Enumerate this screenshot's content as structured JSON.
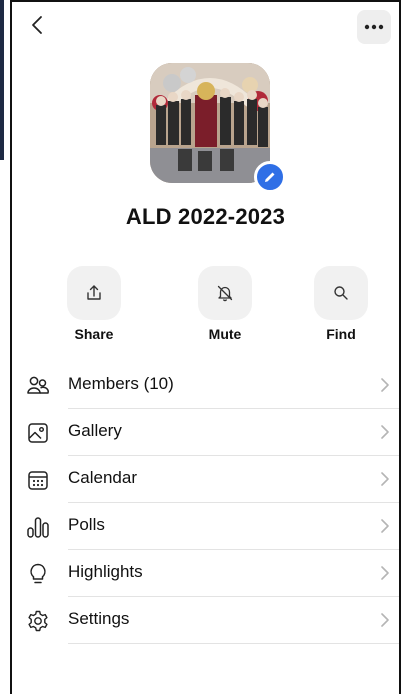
{
  "header": {
    "back_icon": "chevron-left-icon",
    "more_icon": "ellipsis-icon"
  },
  "group": {
    "name": "ALD 2022-2023",
    "photo_description_icon": "group-photo",
    "edit_icon": "pencil-icon",
    "accent_color": "#2f6fe6"
  },
  "actions": [
    {
      "label": "Share",
      "icon": "share-icon"
    },
    {
      "label": "Mute",
      "icon": "bell-off-icon"
    },
    {
      "label": "Find",
      "icon": "search-icon"
    }
  ],
  "menu": [
    {
      "label": "Members (10)",
      "icon": "people-icon"
    },
    {
      "label": "Gallery",
      "icon": "image-icon"
    },
    {
      "label": "Calendar",
      "icon": "calendar-icon"
    },
    {
      "label": "Polls",
      "icon": "poll-icon"
    },
    {
      "label": "Highlights",
      "icon": "lightbulb-icon"
    },
    {
      "label": "Settings",
      "icon": "gear-icon"
    }
  ]
}
